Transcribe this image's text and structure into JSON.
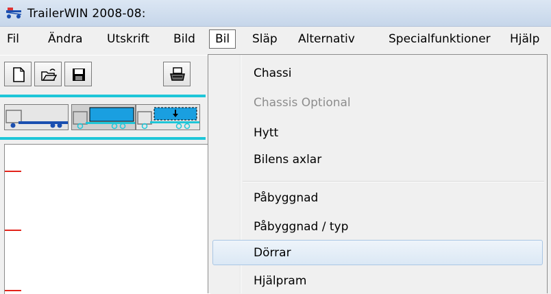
{
  "window": {
    "title": "TrailerWIN 2008-08:"
  },
  "menubar": {
    "items": [
      {
        "label": "Fil"
      },
      {
        "label": "Ändra"
      },
      {
        "label": "Utskrift"
      },
      {
        "label": "Bild"
      },
      {
        "label": "Bil"
      },
      {
        "label": "Släp"
      },
      {
        "label": "Alternativ"
      },
      {
        "label": "Specialfunktioner"
      },
      {
        "label": "Hjälp"
      }
    ],
    "active_index": 4
  },
  "toolbar": {
    "buttons": [
      {
        "icon": "new-document-icon"
      },
      {
        "icon": "open-folder-icon"
      },
      {
        "icon": "save-disk-icon"
      },
      {
        "icon": "print-icon"
      }
    ]
  },
  "vehicle_toolbar": {
    "buttons": [
      {
        "icon": "truck-chassis-icon"
      },
      {
        "icon": "truck-body-icon"
      },
      {
        "icon": "truck-body-down-icon"
      }
    ]
  },
  "dropdown": {
    "items": [
      {
        "label": "Chassi",
        "enabled": true
      },
      {
        "label": "Chassis Optional",
        "enabled": false
      },
      {
        "label": "Hytt",
        "enabled": true
      },
      {
        "label": "Bilens axlar",
        "enabled": true
      },
      {
        "label": "Påbyggnad",
        "enabled": true
      },
      {
        "label": "Påbyggnad / typ",
        "enabled": true
      },
      {
        "label": "Dörrar",
        "enabled": true,
        "highlighted": true
      },
      {
        "label": "Hjälpram",
        "enabled": true
      }
    ]
  },
  "colors": {
    "accent_cyan": "#1ec6d8",
    "truck_blue": "#1a9fe0",
    "ruler_red": "#e2231a",
    "highlight_border": "#a9c6e4"
  }
}
